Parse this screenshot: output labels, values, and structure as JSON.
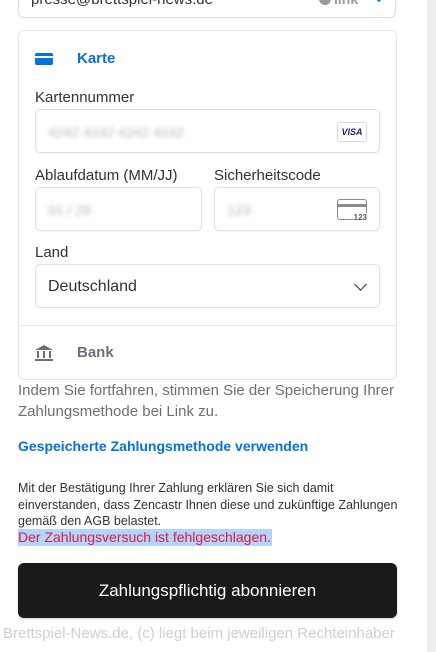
{
  "email_field": {
    "value": "presse@brettspiel-news.de",
    "link_badge": "link"
  },
  "payment_methods": {
    "card": {
      "label": "Karte",
      "card_number": {
        "label": "Kartennummer",
        "value": "4242 4242 4242 4242",
        "brand": "VISA"
      },
      "expiry": {
        "label": "Ablaufdatum (MM/JJ)",
        "value": "01 / 28"
      },
      "cvc": {
        "label": "Sicherheitscode",
        "value": "123",
        "icon_number": "123"
      },
      "country": {
        "label": "Land",
        "value": "Deutschland"
      }
    },
    "bank": {
      "label": "Bank"
    }
  },
  "consent_text": "Indem Sie fortfahren, stimmen Sie der Speicherung Ihrer Zahlungsmethode bei Link zu.",
  "saved_method_link": "Gespeicherte Zahlungsmethode verwenden",
  "terms_text": "Mit der Bestätigung Ihrer Zahlung erklären Sie sich damit einverstanden, dass Zencastr Ihnen diese und zukünftige Zahlungen gemäß den AGB belastet.",
  "error_text": "Der Zahlungsversuch ist fehlgeschlagen.",
  "subscribe_button": "Zahlungspflichtig abonnieren",
  "watermark": "Brettspiel-News.de, (c) liegt beim jeweiligen Rechteinhaber",
  "colors": {
    "accent": "#0570de",
    "error": "#df1b41",
    "button_bg": "#1a1a1a",
    "selection": "#b3d4fc"
  }
}
